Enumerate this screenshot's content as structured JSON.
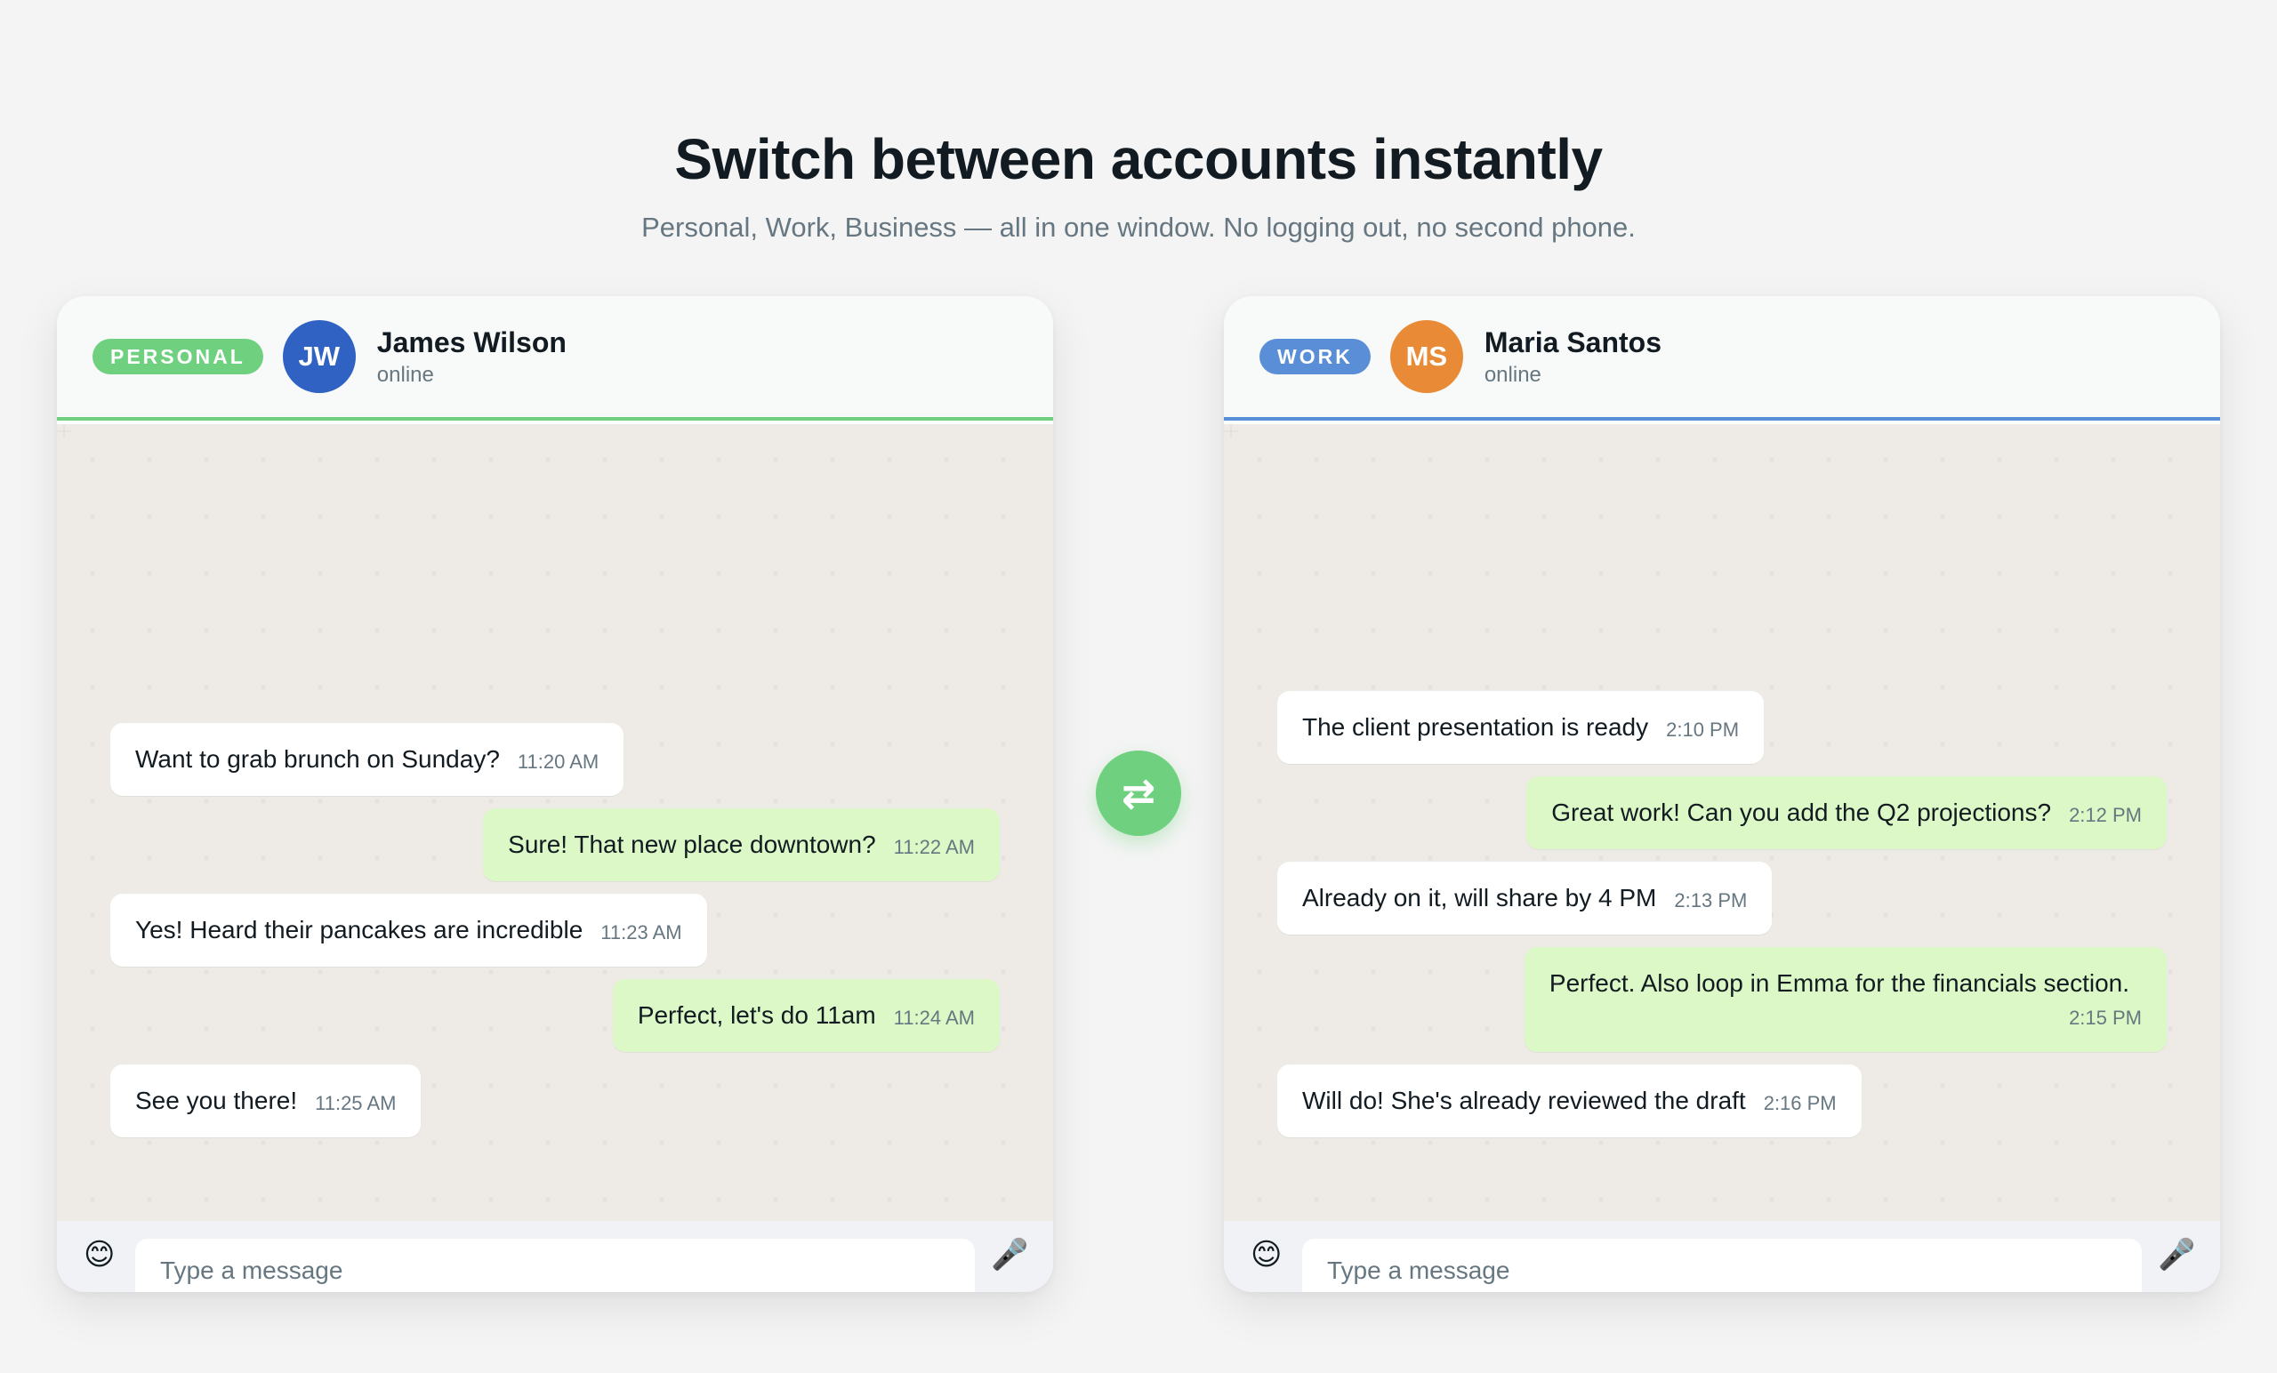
{
  "hero": {
    "title": "Switch between accounts instantly",
    "subtitle": "Personal, Work, Business — all in one window. No logging out, no second phone."
  },
  "panels": [
    {
      "badge": "PERSONAL",
      "accent": "#6fd17f",
      "avatar_initials": "JW",
      "avatar_color": "#2f62c2",
      "contact_name": "James Wilson",
      "contact_status": "online",
      "messages": [
        {
          "dir": "in",
          "text": "Want to grab brunch on Sunday?",
          "time": "11:20 AM"
        },
        {
          "dir": "out",
          "text": "Sure! That new place downtown?",
          "time": "11:22 AM"
        },
        {
          "dir": "in",
          "text": "Yes! Heard their pancakes are incredible",
          "time": "11:23 AM"
        },
        {
          "dir": "out",
          "text": "Perfect, let's do 11am",
          "time": "11:24 AM"
        },
        {
          "dir": "in",
          "text": "See you there!",
          "time": "11:25 AM"
        }
      ],
      "composer": {
        "placeholder": "Type a message",
        "emoji_icon": "😊",
        "mic_icon": "🎤"
      }
    },
    {
      "badge": "WORK",
      "accent": "#5a8fd8",
      "avatar_initials": "MS",
      "avatar_color": "#e98a36",
      "contact_name": "Maria Santos",
      "contact_status": "online",
      "messages": [
        {
          "dir": "in",
          "text": "The client presentation is ready",
          "time": "2:10 PM"
        },
        {
          "dir": "out",
          "text": "Great work! Can you add the Q2 projections?",
          "time": "2:12 PM"
        },
        {
          "dir": "in",
          "text": "Already on it, will share by 4 PM",
          "time": "2:13 PM"
        },
        {
          "dir": "out",
          "text": "Perfect. Also loop in Emma for the financials section.",
          "time": "2:15 PM"
        },
        {
          "dir": "in",
          "text": "Will do! She's already reviewed the draft",
          "time": "2:16 PM"
        }
      ],
      "composer": {
        "placeholder": "Type a message",
        "emoji_icon": "😊",
        "mic_icon": "🎤"
      }
    }
  ],
  "switch_icon": "⇄"
}
